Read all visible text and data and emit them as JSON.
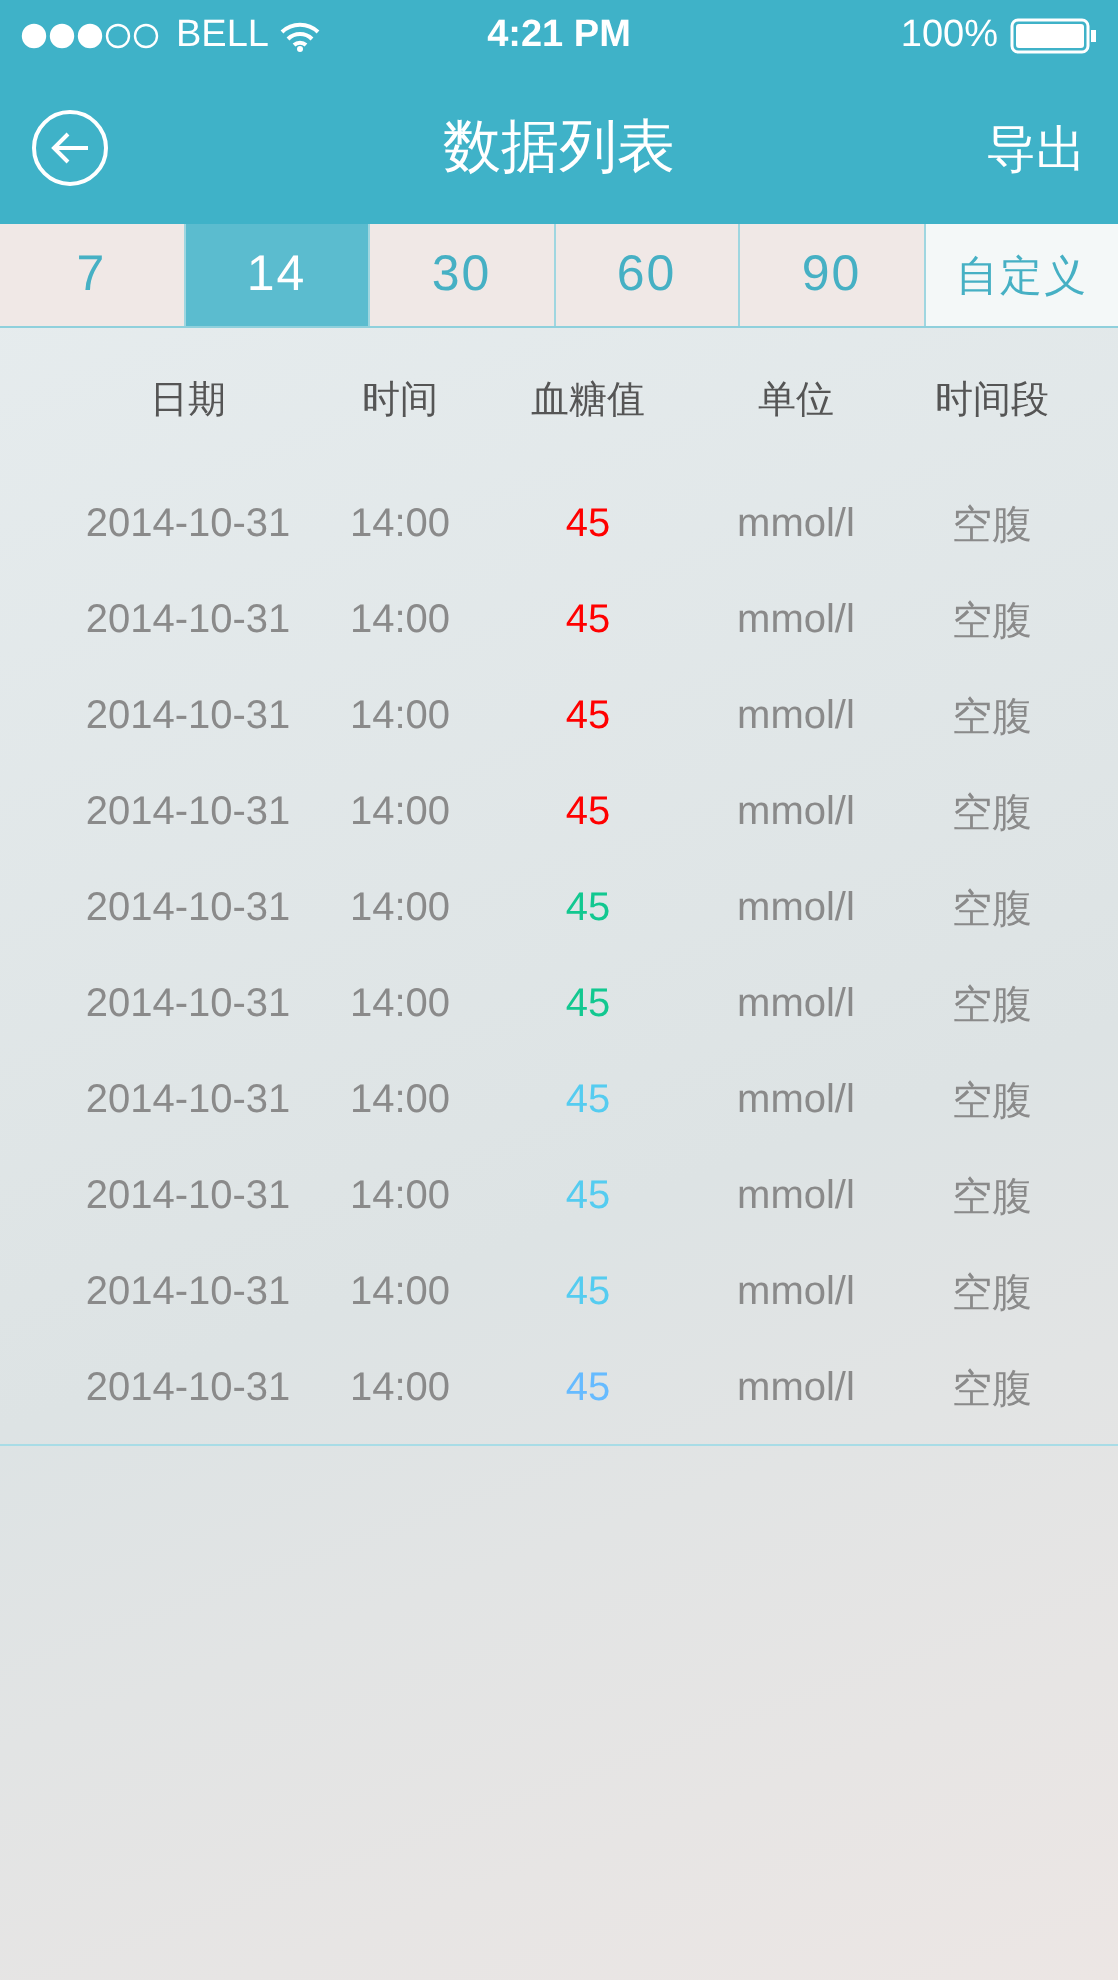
{
  "status_bar": {
    "carrier": "BELL",
    "time": "4:21 PM",
    "battery": "100%"
  },
  "nav_bar": {
    "title": "数据列表",
    "action": "导出"
  },
  "tabs": [
    {
      "label": "7",
      "selected": false
    },
    {
      "label": "14",
      "selected": true
    },
    {
      "label": "30",
      "selected": false
    },
    {
      "label": "60",
      "selected": false
    },
    {
      "label": "90",
      "selected": false
    },
    {
      "label": "自定义",
      "selected": false
    }
  ],
  "table": {
    "columns": [
      "日期",
      "时间",
      "血糖值",
      "单位",
      "时间段"
    ],
    "rows": [
      {
        "date": "2014-10-31",
        "time": "14:00",
        "value": "45",
        "color": "#ff0000",
        "unit": "mmol/l",
        "period": "空腹"
      },
      {
        "date": "2014-10-31",
        "time": "14:00",
        "value": "45",
        "color": "#ff0000",
        "unit": "mmol/l",
        "period": "空腹"
      },
      {
        "date": "2014-10-31",
        "time": "14:00",
        "value": "45",
        "color": "#ff0000",
        "unit": "mmol/l",
        "period": "空腹"
      },
      {
        "date": "2014-10-31",
        "time": "14:00",
        "value": "45",
        "color": "#ff0000",
        "unit": "mmol/l",
        "period": "空腹"
      },
      {
        "date": "2014-10-31",
        "time": "14:00",
        "value": "45",
        "color": "#12c890",
        "unit": "mmol/l",
        "period": "空腹"
      },
      {
        "date": "2014-10-31",
        "time": "14:00",
        "value": "45",
        "color": "#12c890",
        "unit": "mmol/l",
        "period": "空腹"
      },
      {
        "date": "2014-10-31",
        "time": "14:00",
        "value": "45",
        "color": "#55ccf0",
        "unit": "mmol/l",
        "period": "空腹"
      },
      {
        "date": "2014-10-31",
        "time": "14:00",
        "value": "45",
        "color": "#55ccf0",
        "unit": "mmol/l",
        "period": "空腹"
      },
      {
        "date": "2014-10-31",
        "time": "14:00",
        "value": "45",
        "color": "#55ccf0",
        "unit": "mmol/l",
        "period": "空腹"
      },
      {
        "date": "2014-10-31",
        "time": "14:00",
        "value": "45",
        "color": "#66bbff",
        "unit": "mmol/l",
        "period": "空腹"
      }
    ]
  }
}
